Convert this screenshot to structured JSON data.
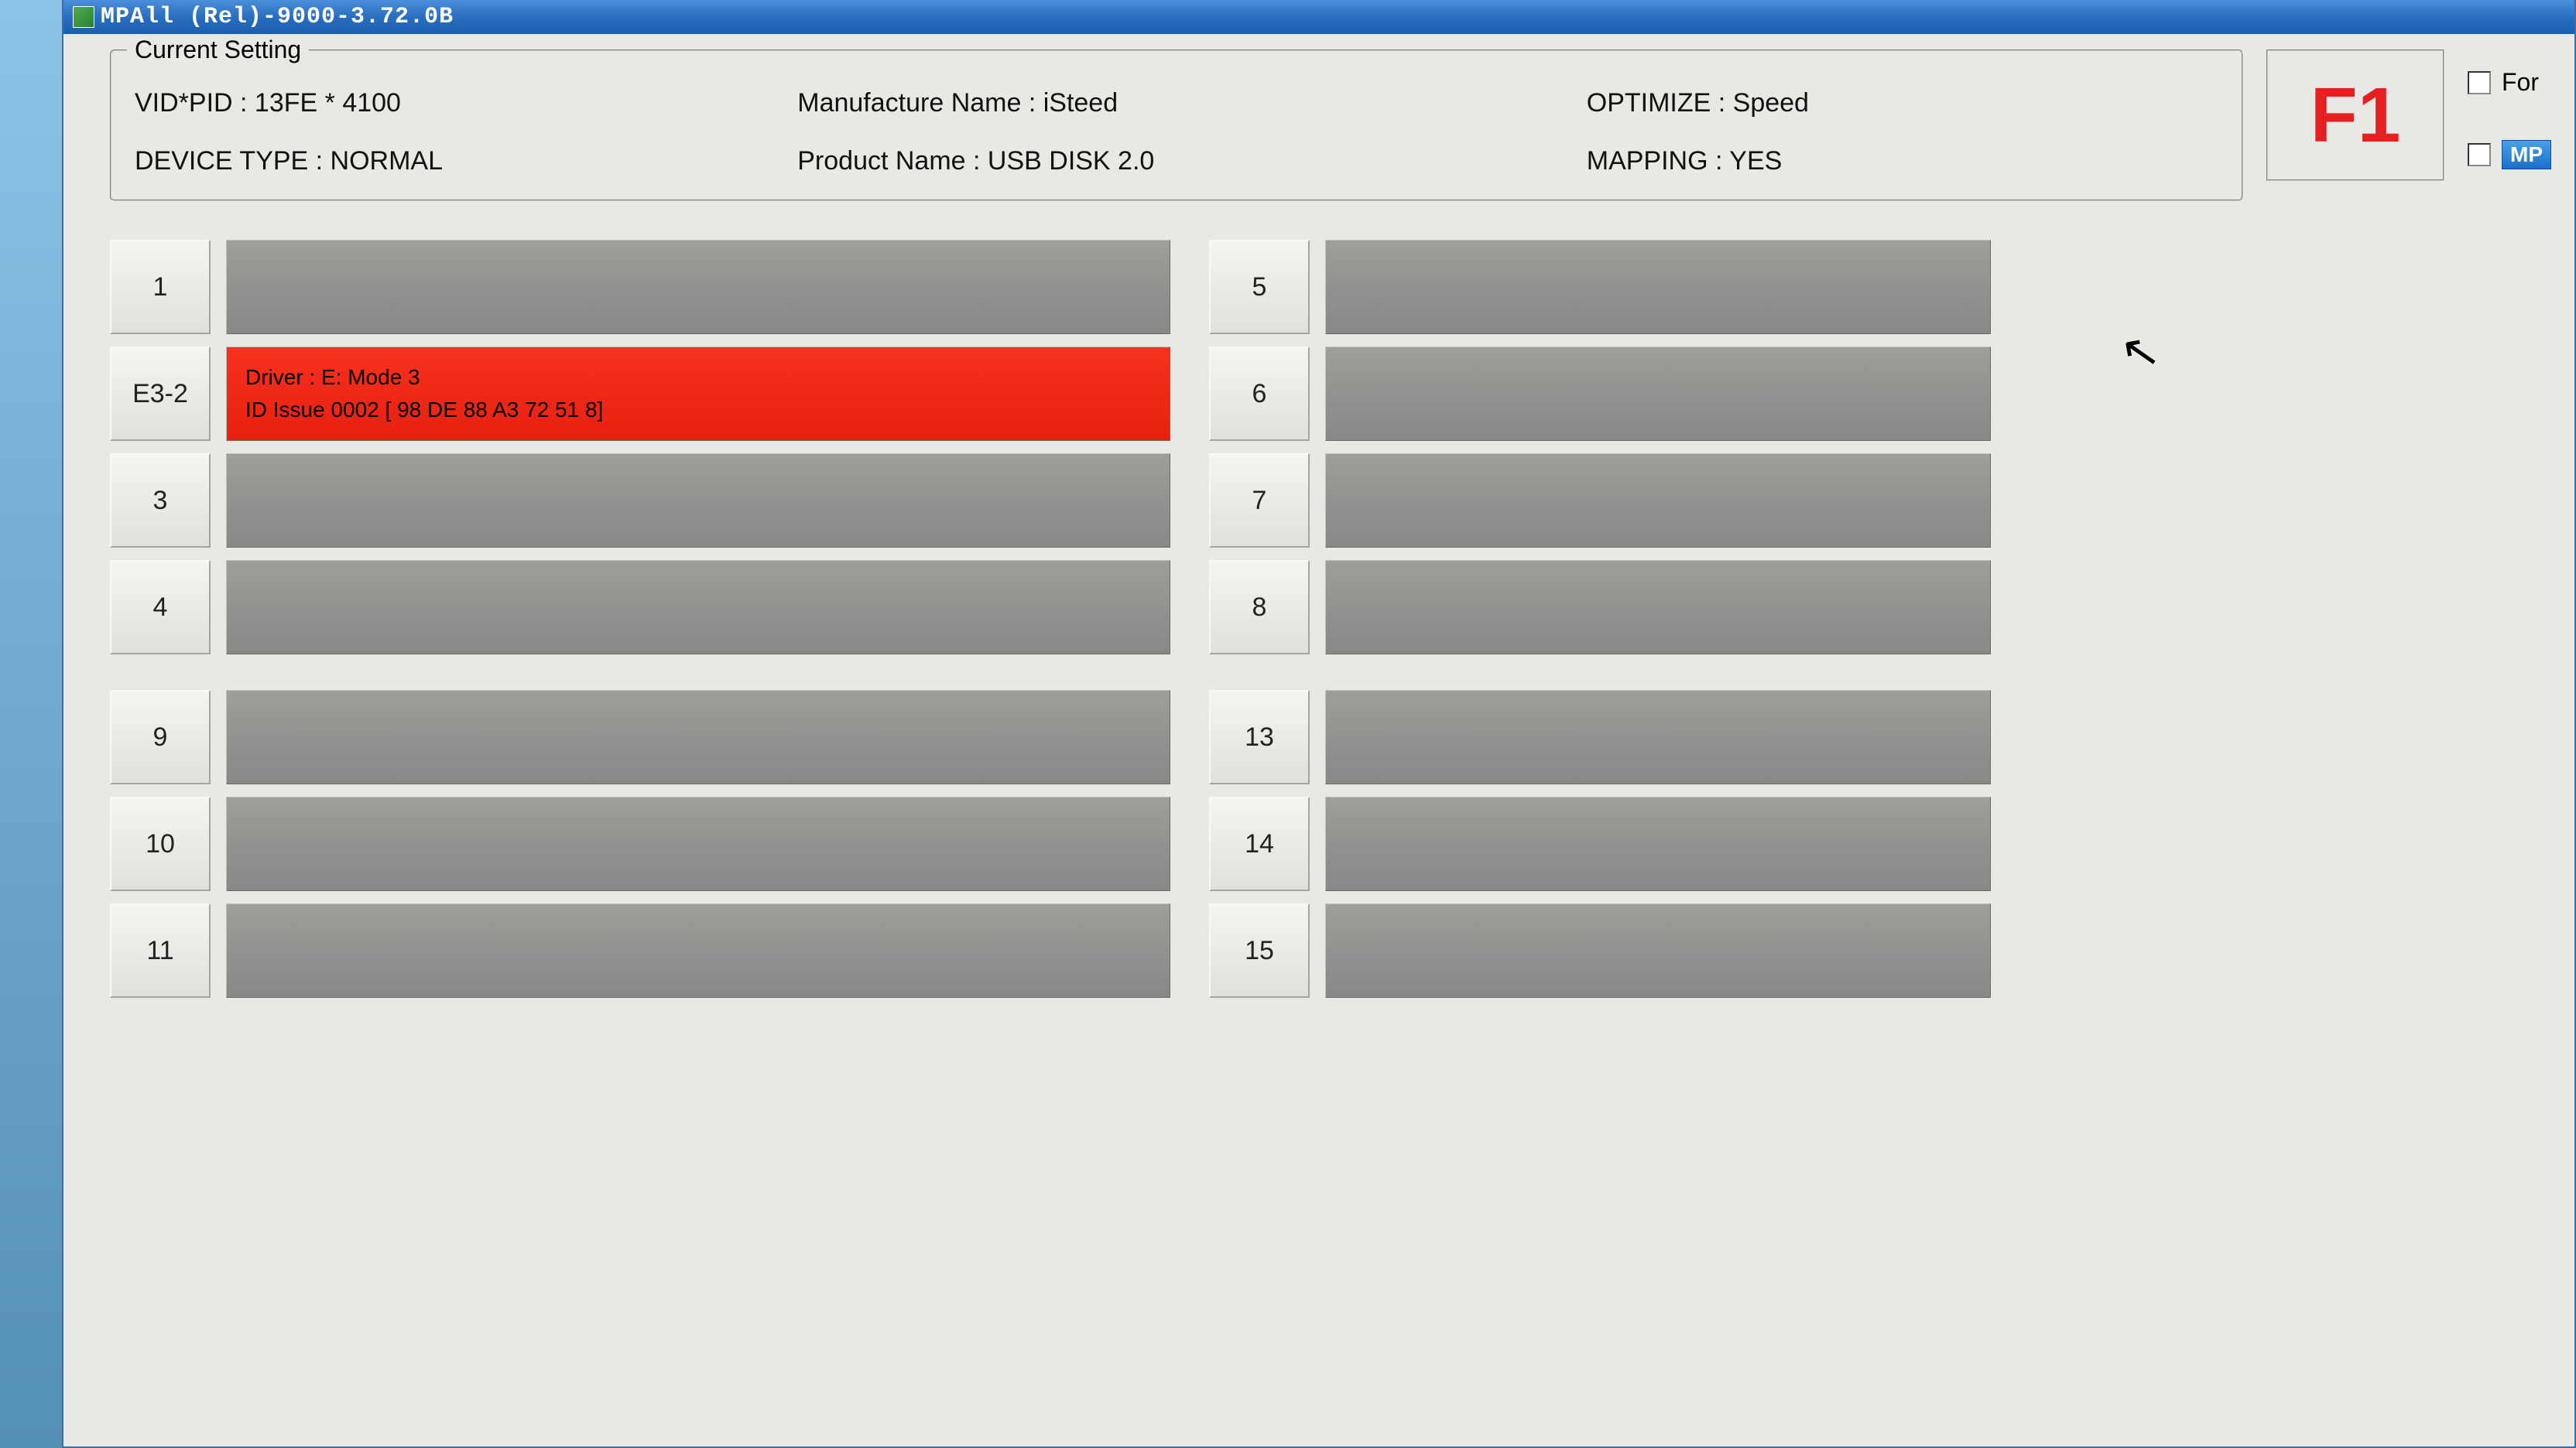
{
  "window": {
    "title": "MPAll (Rel)-9000-3.72.0B"
  },
  "settings": {
    "group_label": "Current Setting",
    "vid_pid": "VID*PID : 13FE * 4100",
    "device_type": "DEVICE TYPE : NORMAL",
    "manufacture": "Manufacture Name : iSteed",
    "product": "Product Name : USB DISK 2.0",
    "optimize": "OPTIMIZE : Speed",
    "mapping": "MAPPING : YES",
    "f1": "F1",
    "check_for": "For",
    "mp_badge": "MP"
  },
  "slots": {
    "left_group_a": [
      {
        "label": "1",
        "status": "",
        "error": false
      },
      {
        "label": "E3-2",
        "status_line1": "Driver : E: Mode 3",
        "status_line2": "ID Issue 0002 [ 98 DE 88 A3 72 51 8]",
        "error": true
      },
      {
        "label": "3",
        "status": "",
        "error": false
      },
      {
        "label": "4",
        "status": "",
        "error": false
      }
    ],
    "left_group_b": [
      {
        "label": "9",
        "status": "",
        "error": false
      },
      {
        "label": "10",
        "status": "",
        "error": false
      },
      {
        "label": "11",
        "status": "",
        "error": false
      }
    ],
    "right_group_a": [
      {
        "label": "5",
        "status": "",
        "error": false
      },
      {
        "label": "6",
        "status": "",
        "error": false
      },
      {
        "label": "7",
        "status": "",
        "error": false
      },
      {
        "label": "8",
        "status": "",
        "error": false
      }
    ],
    "right_group_b": [
      {
        "label": "13",
        "status": "",
        "error": false
      },
      {
        "label": "14",
        "status": "",
        "error": false
      },
      {
        "label": "15",
        "status": "",
        "error": false
      }
    ]
  }
}
